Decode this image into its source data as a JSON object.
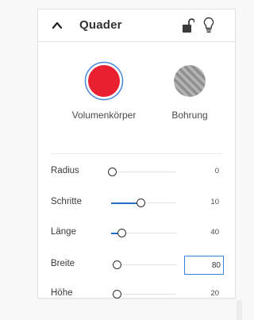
{
  "panel": {
    "title": "Quader",
    "icons": {
      "collapse": "chevron-up-icon",
      "lock": "unlocked-icon",
      "visibility": "lightbulb-icon"
    }
  },
  "modes": [
    {
      "label": "Volumenkörper",
      "selected": true,
      "color": "#e8202f"
    },
    {
      "label": "Bohrung",
      "selected": false,
      "color": "#a8a8a8"
    }
  ],
  "params": [
    {
      "label": "Radius",
      "value": "0",
      "slider_fraction": 0.0
    },
    {
      "label": "Schritte",
      "value": "10",
      "slider_fraction": 0.45
    },
    {
      "label": "Länge",
      "value": "40",
      "slider_fraction": 0.15
    },
    {
      "label": "Breite",
      "value": "80",
      "slider_fraction": 0.05,
      "editing": true
    },
    {
      "label": "Höhe",
      "value": "20",
      "slider_fraction": 0.05
    }
  ],
  "colors": {
    "accent": "#2a6bc4",
    "focus_border": "#3b7ddd",
    "solid_red": "#e8202f"
  }
}
